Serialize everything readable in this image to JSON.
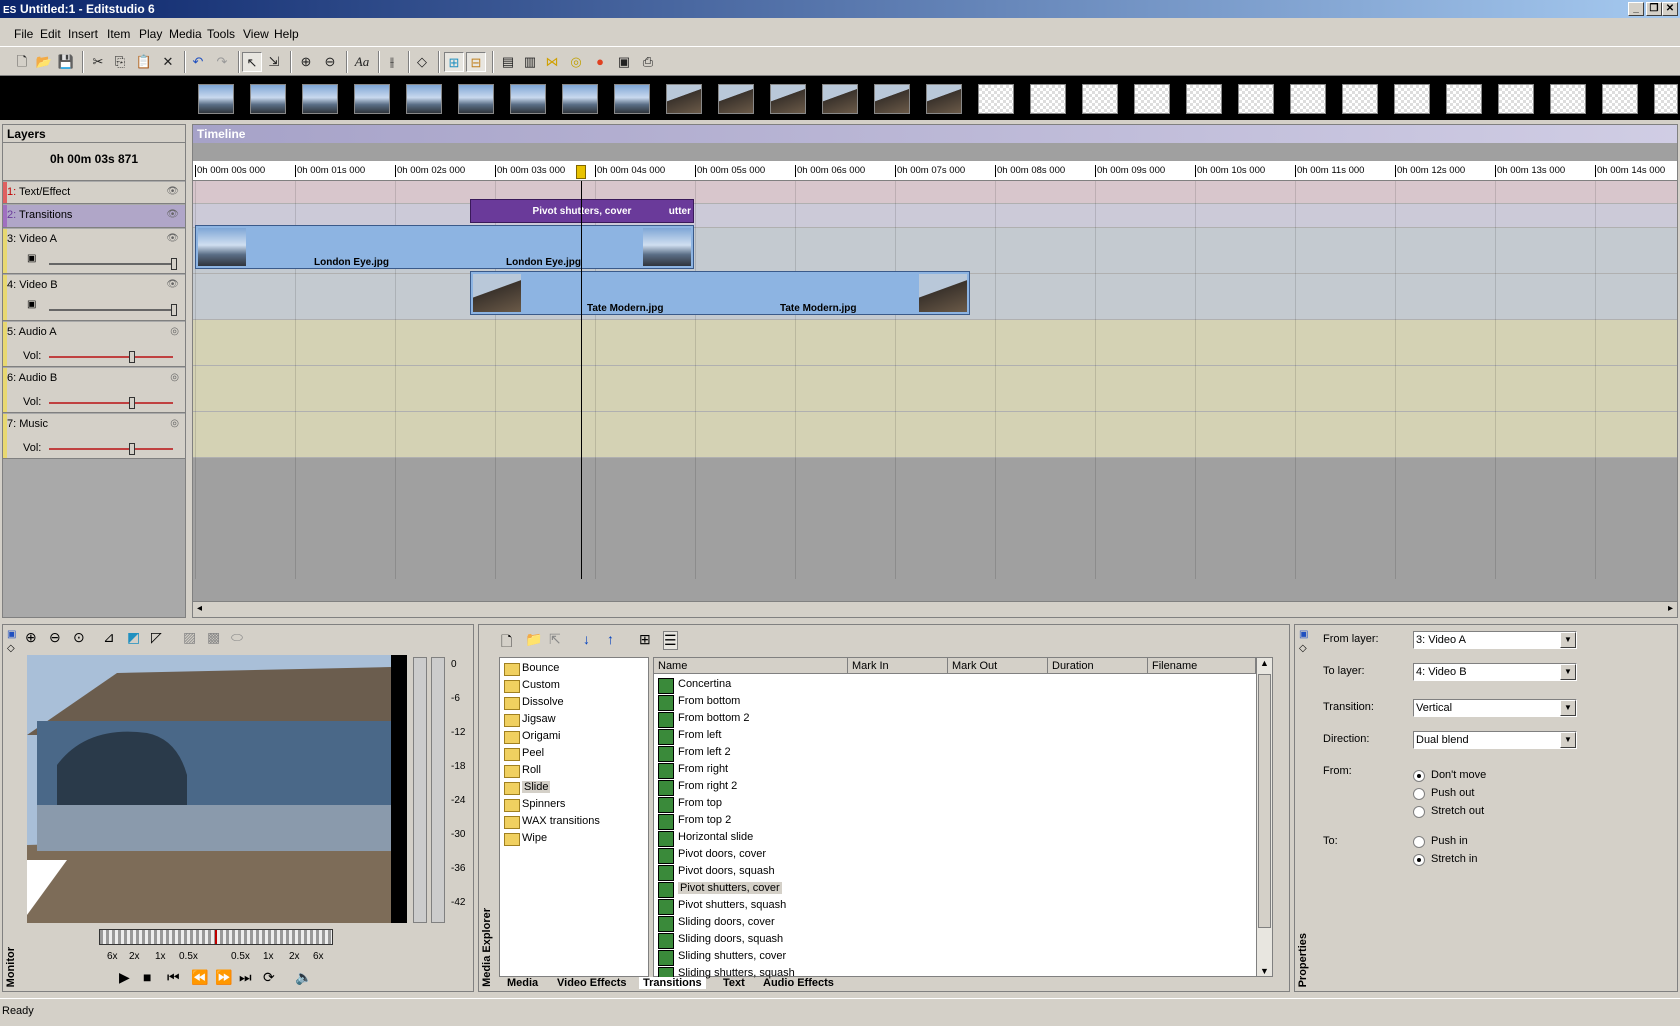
{
  "window": {
    "title": "Untitled:1 - Editstudio 6",
    "app_icon": "ES"
  },
  "menu": [
    "File",
    "Edit",
    "Insert",
    "Item",
    "Play",
    "Media",
    "Tools",
    "View",
    "Help"
  ],
  "layers": {
    "header": "Layers",
    "current_time": "0h 00m 03s 871",
    "items": [
      {
        "num": "1:",
        "name": "Text/Effect",
        "color": "#e06060"
      },
      {
        "num": "2:",
        "name": "Transitions",
        "color": "#a070c0"
      },
      {
        "num": "3:",
        "name": "Video A",
        "color": "#e8d870"
      },
      {
        "num": "4:",
        "name": "Video B",
        "color": "#e8d870"
      },
      {
        "num": "5:",
        "name": "Audio A",
        "color": "#e8d870",
        "vol_label": "Vol:"
      },
      {
        "num": "6:",
        "name": "Audio B",
        "color": "#e8d870",
        "vol_label": "Vol:"
      },
      {
        "num": "7:",
        "name": "Music",
        "color": "#e8d870",
        "vol_label": "Vol:"
      }
    ]
  },
  "timeline": {
    "header": "Timeline",
    "ticks": [
      "0h 00m 00s 000",
      "0h 00m 01s 000",
      "0h 00m 02s 000",
      "0h 00m 03s 000",
      "0h 00m 04s 000",
      "0h 00m 05s 000",
      "0h 00m 06s 000",
      "0h 00m 07s 000",
      "0h 00m 08s 000",
      "0h 00m 09s 000",
      "0h 00m 10s 000",
      "0h 00m 11s 000",
      "0h 00m 12s 000",
      "0h 00m 13s 000",
      "0h 00m 14s 000"
    ],
    "transition_clip": {
      "label": "Pivot shutters, cover",
      "tail": "utter"
    },
    "video_a_clip": {
      "label1": "London Eye.jpg",
      "label2": "London Eye.jpg"
    },
    "video_b_clip": {
      "label1": "Tate Modern.jpg",
      "label2": "Tate Modern.jpg"
    }
  },
  "monitor": {
    "tab": "Monitor",
    "levels": [
      "0",
      "-6",
      "-12",
      "-18",
      "-24",
      "-30",
      "-36",
      "-42"
    ],
    "speeds": [
      "6x",
      "2x",
      "1x",
      "0.5x",
      "0.5x",
      "1x",
      "2x",
      "6x"
    ]
  },
  "media_explorer": {
    "tab": "Media Explorer",
    "folders": [
      "Bounce",
      "Custom",
      "Dissolve",
      "Jigsaw",
      "Origami",
      "Peel",
      "Roll",
      "Slide",
      "Spinners",
      "WAX transitions",
      "Wipe"
    ],
    "selected_folder": "Slide",
    "columns": [
      "Name",
      "Mark In",
      "Mark Out",
      "Duration",
      "Filename"
    ],
    "files": [
      "Concertina",
      "From bottom",
      "From bottom 2",
      "From left",
      "From left 2",
      "From right",
      "From right 2",
      "From top",
      "From top 2",
      "Horizontal slide",
      "Pivot doors, cover",
      "Pivot doors, squash",
      "Pivot shutters, cover",
      "Pivot shutters, squash",
      "Sliding doors, cover",
      "Sliding doors, squash",
      "Sliding shutters, cover",
      "Sliding shutters, squash"
    ],
    "selected_file": "Pivot shutters, cover",
    "bottom_tabs": [
      "Media",
      "Video Effects",
      "Transitions",
      "Text",
      "Audio Effects"
    ],
    "active_tab": "Transitions"
  },
  "properties": {
    "tab": "Properties",
    "from_layer_label": "From layer:",
    "from_layer": "3: Video A",
    "to_layer_label": "To layer:",
    "to_layer": "4: Video B",
    "transition_label": "Transition:",
    "transition": "Vertical",
    "direction_label": "Direction:",
    "direction": "Dual blend",
    "from_label": "From:",
    "from_options": [
      "Don't move",
      "Push out",
      "Stretch out"
    ],
    "from_selected": "Don't move",
    "to_label": "To:",
    "to_options": [
      "Push in",
      "Stretch in"
    ],
    "to_selected": "Stretch in"
  },
  "status": "Ready"
}
